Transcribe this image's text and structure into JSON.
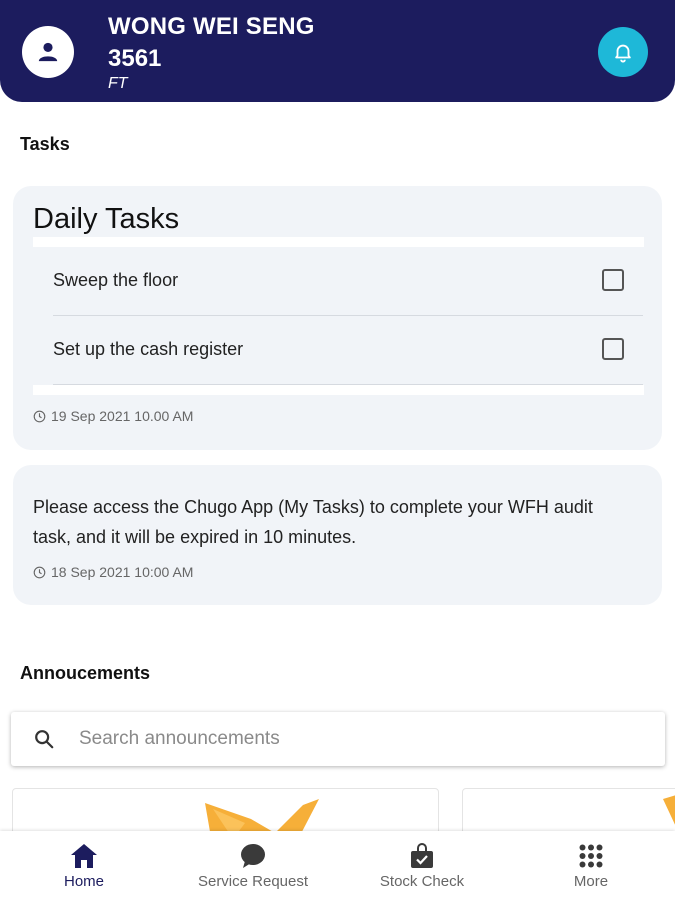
{
  "header": {
    "user_name": "WONG WEI SENG",
    "user_id": "3561",
    "user_type": "FT"
  },
  "tasks_section": {
    "title": "Tasks",
    "daily": {
      "title": "Daily Tasks",
      "items": [
        {
          "label": "Sweep the floor",
          "checked": false
        },
        {
          "label": "Set up the cash register",
          "checked": false
        }
      ],
      "timestamp": "19 Sep 2021 10.00 AM"
    },
    "notice": {
      "text": "Please access the Chugo App (My Tasks) to complete your WFH audit task, and it will be expired in 10 minutes.",
      "timestamp": "18 Sep 2021 10:00 AM"
    }
  },
  "announcements": {
    "title": "Annoucements",
    "search_placeholder": "Search announcements"
  },
  "nav": {
    "items": [
      {
        "label": "Home",
        "icon": "home-icon",
        "active": true
      },
      {
        "label": "Service Request",
        "icon": "chat-bubble-icon",
        "active": false
      },
      {
        "label": "Stock Check",
        "icon": "shopping-bag-check-icon",
        "active": false
      },
      {
        "label": "More",
        "icon": "grid-dots-icon",
        "active": false
      }
    ]
  },
  "colors": {
    "header_bg": "#1c1c5e",
    "bell_bg": "#1eb8d8",
    "card_bg": "#f1f4f8",
    "accent_orange": "#f5a623"
  }
}
